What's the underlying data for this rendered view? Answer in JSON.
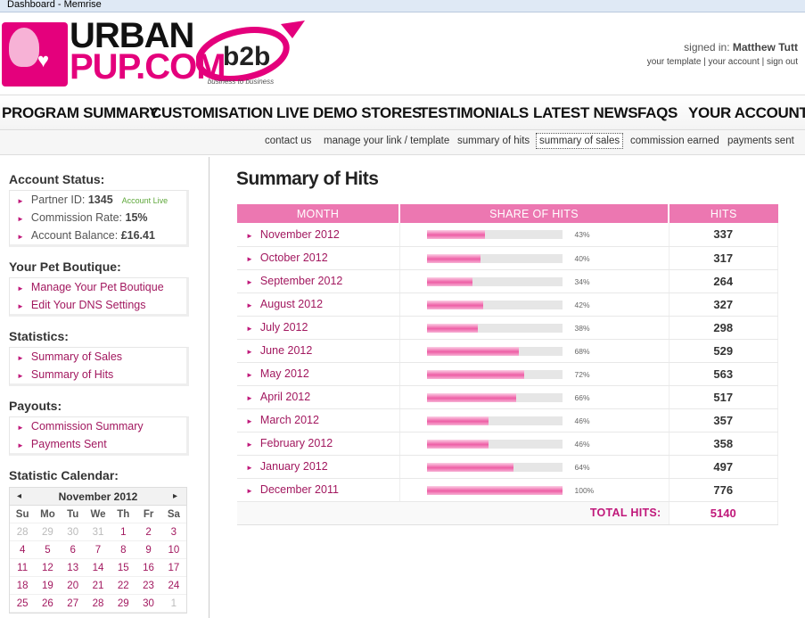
{
  "window": {
    "title": "Dashboard - Memrise"
  },
  "brand": {
    "logo_top": "URBAN",
    "logo_bottom": "PUP.COM",
    "b2b": "b2b",
    "b2b_tagline": "business to business",
    "accent": "#e4007c"
  },
  "account": {
    "signed_in_label": "signed in:",
    "user": "Matthew Tutt",
    "links": [
      "your template",
      "your account",
      "sign out"
    ]
  },
  "main_nav": [
    "PROGRAM SUMMARY",
    "CUSTOMISATION",
    "LIVE DEMO STORES",
    "TESTIMONIALS",
    "LATEST NEWS",
    "FAQS",
    "YOUR ACCOUNT"
  ],
  "sub_nav": [
    "contact us",
    "manage your link / template",
    "summary of hits",
    "summary of sales",
    "commission earned",
    "payments sent"
  ],
  "sidebar": {
    "account_status": {
      "title": "Account Status:",
      "partner_label": "Partner ID:",
      "partner_id": "1345",
      "live_badge": "Account Live",
      "commission_label": "Commission Rate:",
      "commission_rate": "15%",
      "balance_label": "Account Balance:",
      "balance": "£16.41"
    },
    "boutique": {
      "title": "Your Pet Boutique:",
      "items": [
        "Manage Your Pet Boutique",
        "Edit Your DNS Settings"
      ]
    },
    "statistics": {
      "title": "Statistics:",
      "items": [
        "Summary of Sales",
        "Summary of Hits"
      ]
    },
    "payouts": {
      "title": "Payouts:",
      "items": [
        "Commission Summary",
        "Payments Sent"
      ]
    },
    "calendar": {
      "title": "Statistic Calendar:",
      "month": "November 2012",
      "prev": "◂",
      "next": "▸",
      "weekdays": [
        "Su",
        "Mo",
        "Tu",
        "We",
        "Th",
        "Fr",
        "Sa"
      ],
      "days": [
        "28",
        "29",
        "30",
        "31",
        "1",
        "2",
        "3",
        "4",
        "5",
        "6",
        "7",
        "8",
        "9",
        "10",
        "11",
        "12",
        "13",
        "14",
        "15",
        "16",
        "17",
        "18",
        "19",
        "20",
        "21",
        "22",
        "23",
        "24",
        "25",
        "26",
        "27",
        "28",
        "29",
        "30",
        "1"
      ],
      "muted": [
        0,
        1,
        2,
        3,
        34
      ]
    }
  },
  "content": {
    "title": "Summary of Hits",
    "columns": [
      "MONTH",
      "SHARE OF HITS",
      "HITS"
    ],
    "rows": [
      {
        "month": "November 2012",
        "share": 43,
        "share_label": "43%",
        "hits": "337"
      },
      {
        "month": "October 2012",
        "share": 40,
        "share_label": "40%",
        "hits": "317"
      },
      {
        "month": "September 2012",
        "share": 34,
        "share_label": "34%",
        "hits": "264"
      },
      {
        "month": "August 2012",
        "share": 42,
        "share_label": "42%",
        "hits": "327"
      },
      {
        "month": "July 2012",
        "share": 38,
        "share_label": "38%",
        "hits": "298"
      },
      {
        "month": "June 2012",
        "share": 68,
        "share_label": "68%",
        "hits": "529"
      },
      {
        "month": "May 2012",
        "share": 72,
        "share_label": "72%",
        "hits": "563"
      },
      {
        "month": "April 2012",
        "share": 66,
        "share_label": "66%",
        "hits": "517"
      },
      {
        "month": "March 2012",
        "share": 46,
        "share_label": "46%",
        "hits": "357"
      },
      {
        "month": "February 2012",
        "share": 46,
        "share_label": "46%",
        "hits": "358"
      },
      {
        "month": "January 2012",
        "share": 64,
        "share_label": "64%",
        "hits": "497"
      },
      {
        "month": "December 2011",
        "share": 100,
        "share_label": "100%",
        "hits": "776"
      }
    ],
    "total_label": "TOTAL HITS:",
    "total": "5140"
  }
}
